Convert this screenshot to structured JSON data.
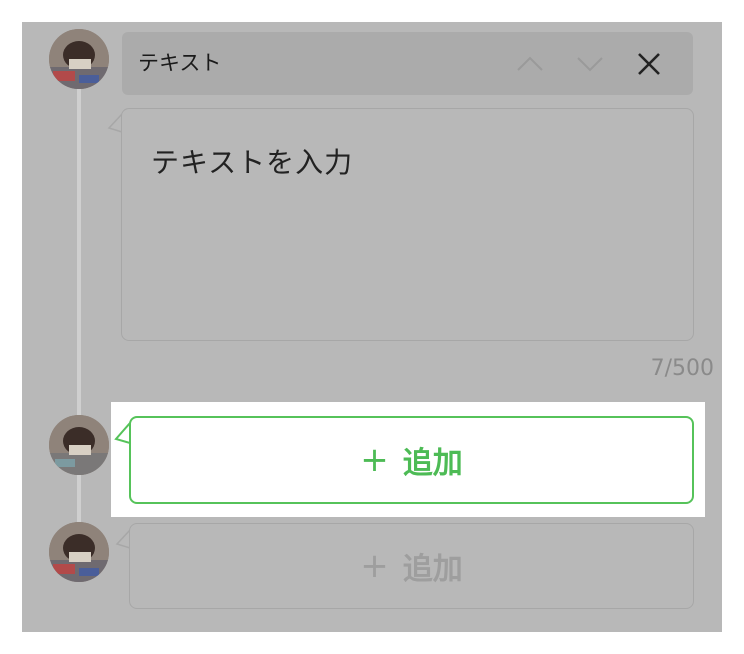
{
  "header": {
    "title": "テキスト"
  },
  "message": {
    "text": "テキストを入力",
    "char_count": "7",
    "char_limit": "/500"
  },
  "add_active": {
    "plus": "+",
    "label": "追加"
  },
  "add_disabled": {
    "plus": "+",
    "label": "追加"
  },
  "colors": {
    "overlay": "#b8b8b8",
    "accent": "#4dbb55",
    "panel": "#ffffff"
  },
  "icons": [
    "avatar",
    "chevron-up-icon",
    "chevron-down-icon",
    "close-icon",
    "plus-icon"
  ]
}
